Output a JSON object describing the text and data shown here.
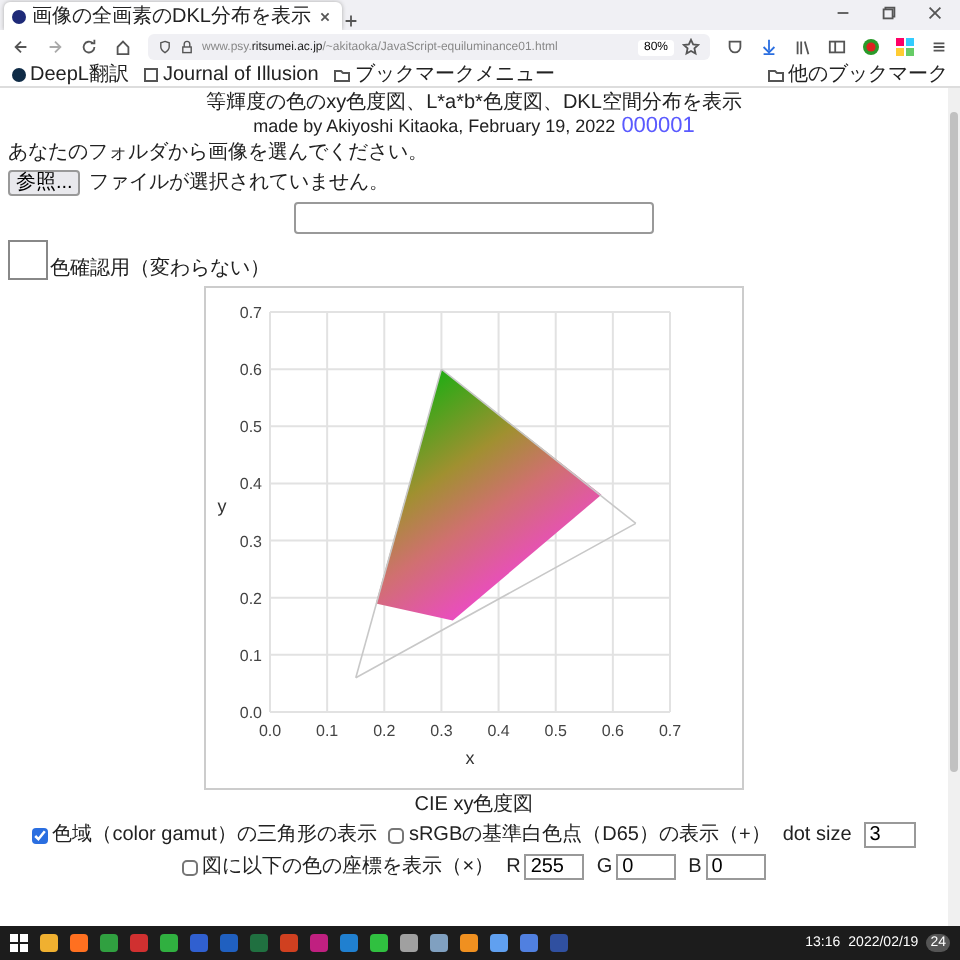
{
  "browser": {
    "tab_title": "画像の全画素のDKL分布を表示",
    "url": {
      "prefix": "www.psy.",
      "domain": "ritsumei.ac.jp",
      "path": "/~akitaoka/JavaScript-equiluminance01.html"
    },
    "zoom": "80%",
    "bookmarks": [
      {
        "label": "DeepL翻訳",
        "kind": "site"
      },
      {
        "label": "Journal of Illusion",
        "kind": "pdf"
      },
      {
        "label": "ブックマークメニュー",
        "kind": "folder"
      }
    ],
    "other_bookmarks": "他のブックマーク"
  },
  "page": {
    "header": "等輝度の色のxy色度図、L*a*b*色度図、DKL空間分布を表示",
    "credit": "made by Akiyoshi Kitaoka, February 19, 2022",
    "counter": "000001",
    "file_prompt": "あなたのフォルダから画像を選んでください。",
    "file_button": "参照...",
    "file_status": "ファイルが選択されていません。",
    "swatch_label": "色確認用（変わらない）",
    "chart_data": {
      "type": "line",
      "xlabel": "x",
      "ylabel": "y",
      "x": [
        0.15,
        0.185,
        0.3,
        0.58,
        0.32,
        0.64,
        0.185
      ],
      "grid": true,
      "series": [
        {
          "type": "area",
          "values": [
            null,
            0.19,
            0.6,
            0.38,
            0.16,
            null,
            0.19
          ]
        },
        {
          "type": "line",
          "color": "#c8c8c8",
          "values": [
            0.06,
            null,
            0.6,
            null,
            null,
            null,
            null
          ]
        },
        {
          "type": "line",
          "color": "#c8c8c8",
          "values": [
            null,
            null,
            0.6,
            null,
            null,
            0.33,
            null
          ]
        },
        {
          "type": "line",
          "color": "#c8c8c8",
          "values": [
            0.06,
            null,
            null,
            null,
            null,
            0.33,
            null
          ]
        }
      ],
      "xlim": [
        0,
        0.7
      ],
      "ylim": [
        0,
        0.7
      ],
      "xticks": [
        {
          "value": 0,
          "label": "0.0"
        },
        0.1,
        0.2,
        0.3,
        0.4,
        0.5,
        0.6,
        0.7
      ],
      "yticks": [
        {
          "value": 0,
          "label": "0.0"
        },
        0.1,
        0.2,
        0.3,
        0.4,
        0.5,
        0.6,
        0.7
      ]
    },
    "chart_caption": "CIE xy色度図",
    "options": [
      {
        "label": "色域（color gamut）の三角形の表示",
        "checked": true
      },
      {
        "label": "sRGBの基準白色点（D65）の表示（+）",
        "checked": false
      }
    ],
    "dot_size": {
      "label": "dot size",
      "value": "3"
    },
    "coord_option": {
      "label": "図に以下の色の座標を表示（×）",
      "checked": false
    },
    "rgb": [
      {
        "label": "R",
        "value": "255"
      },
      {
        "label": "G",
        "value": "0"
      },
      {
        "label": "B",
        "value": "0"
      }
    ]
  },
  "taskbar": {
    "time": "13:16",
    "date": "2022/02/19",
    "notifications": "24"
  }
}
